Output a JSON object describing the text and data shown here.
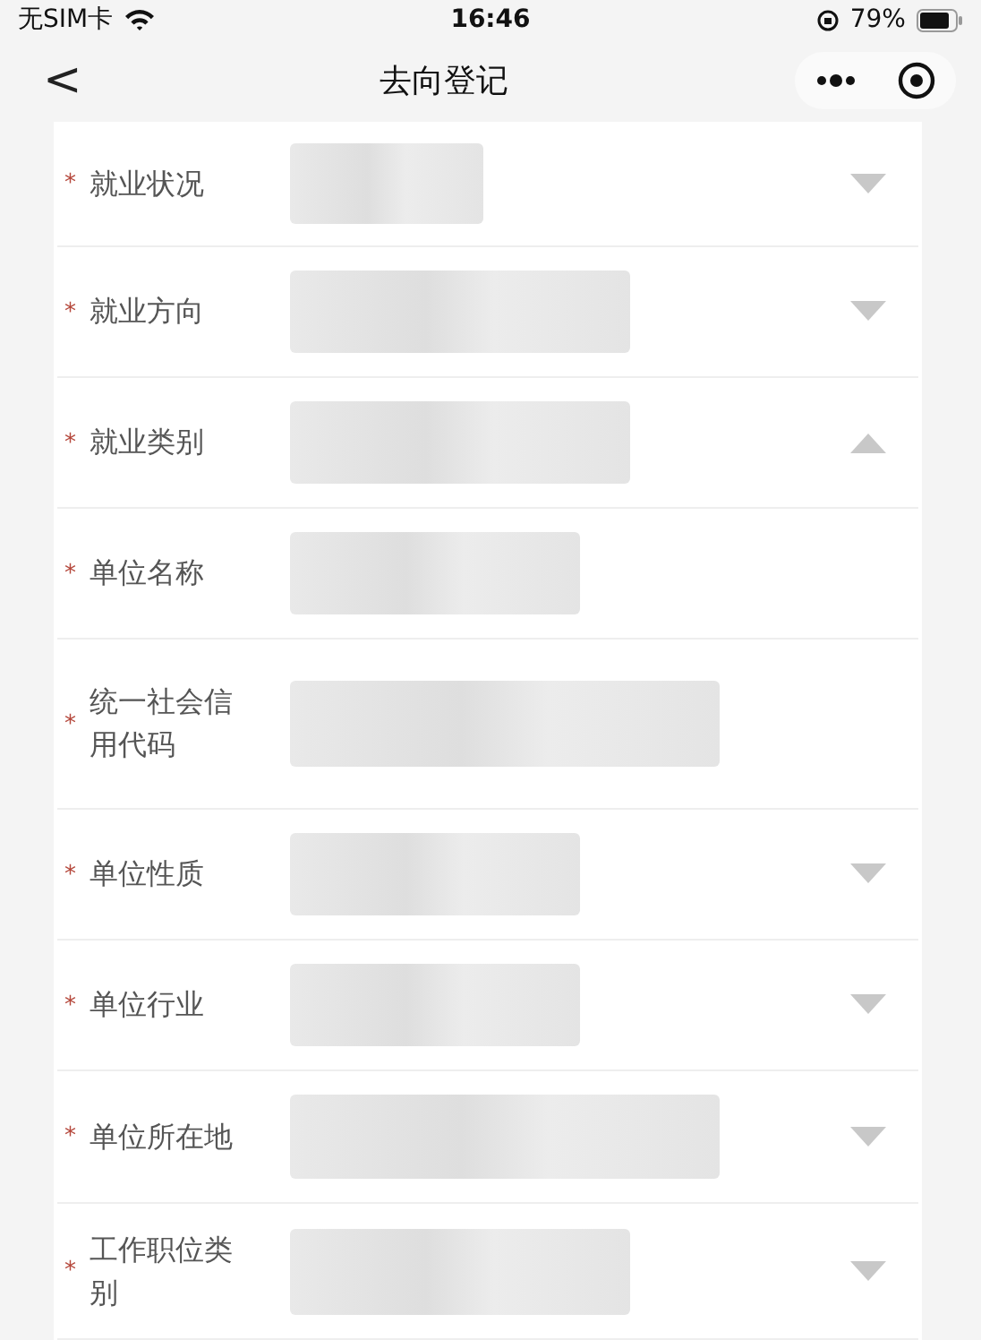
{
  "status_bar": {
    "carrier": "无SIM卡",
    "time": "16:46",
    "battery": "79%"
  },
  "nav": {
    "title": "去向登记",
    "back": "<"
  },
  "fields": [
    {
      "mark": "*",
      "label": "就业状况",
      "kind": "select",
      "expanded": false
    },
    {
      "mark": "*",
      "label": "就业方向",
      "kind": "select",
      "expanded": false
    },
    {
      "mark": "*",
      "label": "就业类别",
      "kind": "select",
      "expanded": true
    },
    {
      "mark": "*",
      "label": "单位名称",
      "kind": "input"
    },
    {
      "mark": "*",
      "label": "统一社会信用代码",
      "kind": "input"
    },
    {
      "mark": "*",
      "label": "单位性质",
      "kind": "select",
      "expanded": false
    },
    {
      "mark": "*",
      "label": "单位行业",
      "kind": "select",
      "expanded": false
    },
    {
      "mark": "*",
      "label": "单位所在地",
      "kind": "select",
      "expanded": false
    },
    {
      "mark": "*",
      "label": "工作职位类别",
      "kind": "select",
      "expanded": false
    }
  ]
}
